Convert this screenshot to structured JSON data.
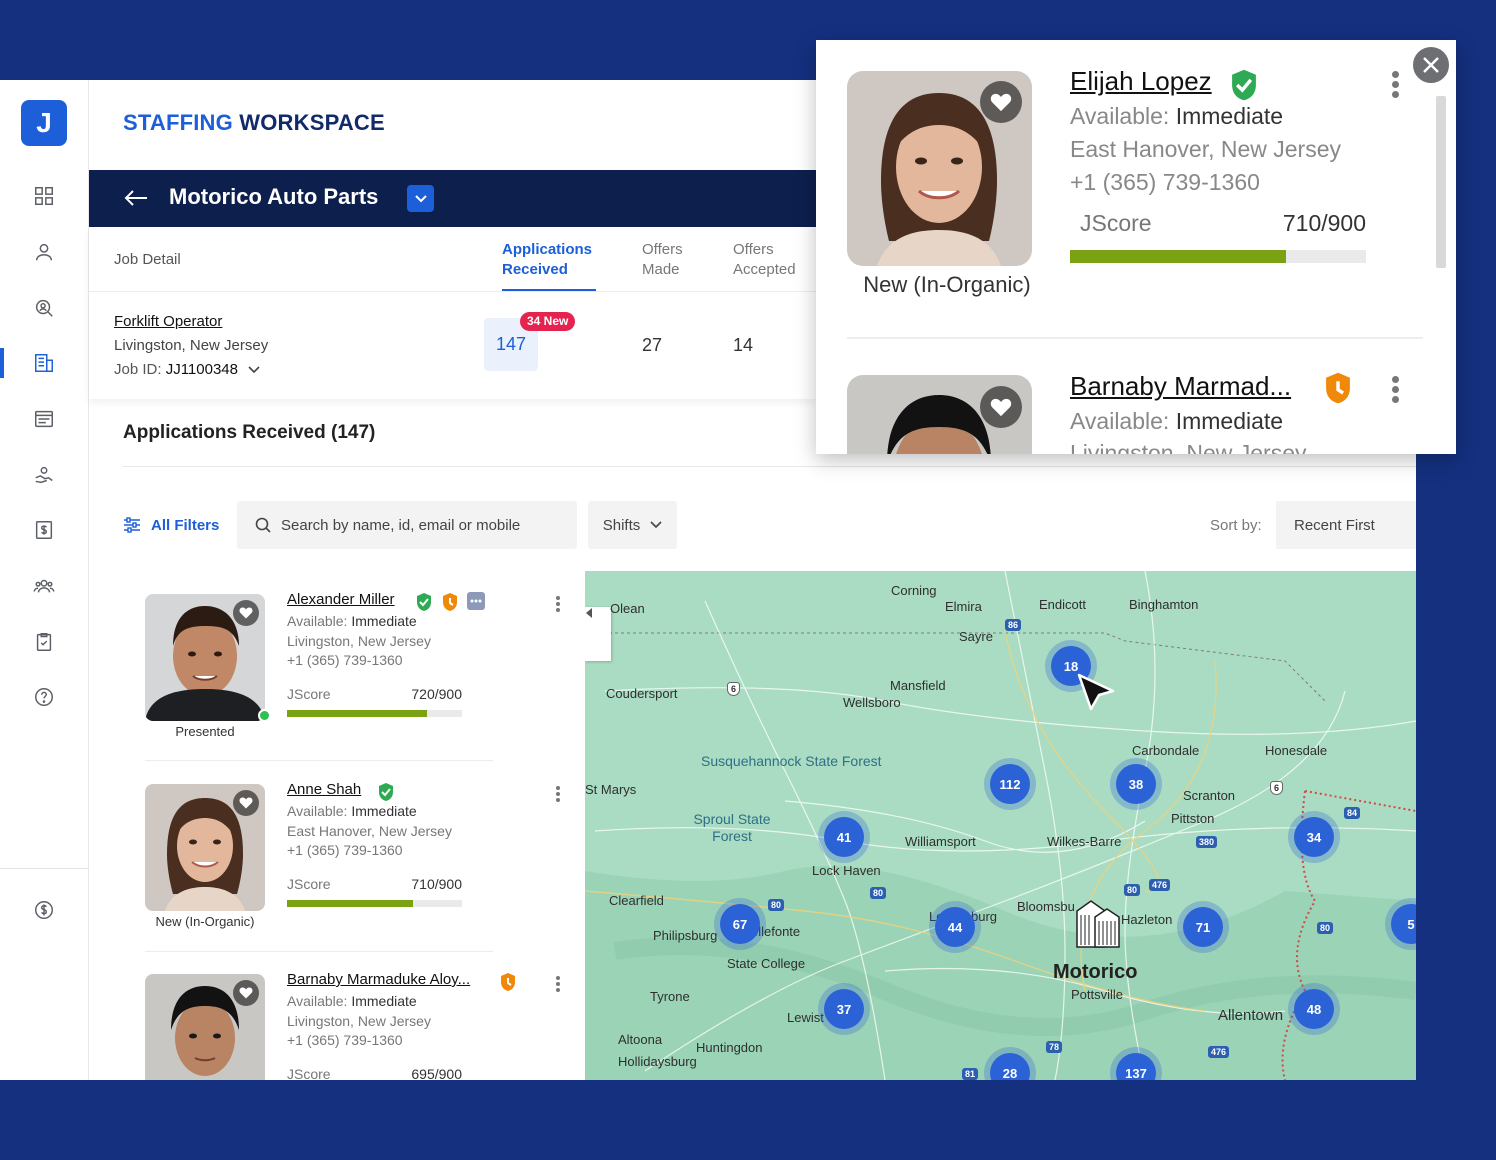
{
  "brand": {
    "part1": "STAFFING",
    "part2": "WORKSPACE",
    "logo_letter": "J"
  },
  "company": {
    "name": "Motorico Auto Parts"
  },
  "job_card": {
    "job_detail_label": "Job Detail",
    "columns": [
      {
        "label_line1": "Applications",
        "label_line2": "Received",
        "value": "147",
        "active": true
      },
      {
        "label_line1": "Offers",
        "label_line2": "Made",
        "value": "27"
      },
      {
        "label_line1": "Offers",
        "label_line2": "Accepted",
        "value": "14"
      }
    ],
    "new_badge": "34 New",
    "job_title": "Forklift Operator",
    "location": "Livingston, New Jersey",
    "job_id_label": "Job ID:",
    "job_id": "JJ1100348"
  },
  "section": {
    "title": "Applications Received (147)"
  },
  "filters": {
    "all_filters": "All Filters",
    "search_placeholder": "Search by name, id, email or mobile",
    "shifts": "Shifts",
    "sort_label": "Sort by:",
    "sort_value": "Recent First"
  },
  "candidates": [
    {
      "name": "Alexander Miller",
      "available_label": "Available:",
      "available": "Immediate",
      "location": "Livingston, New Jersey",
      "phone": "+1 (365) 739-1360",
      "jscore_label": "JScore",
      "jscore": "720/900",
      "jscore_fraction": 0.8,
      "status": "Presented"
    },
    {
      "name": "Anne Shah",
      "available_label": "Available:",
      "available": "Immediate",
      "location": "East Hanover, New Jersey",
      "phone": "+1 (365) 739-1360",
      "jscore_label": "JScore",
      "jscore": "710/900",
      "jscore_fraction": 0.72,
      "status": "New (In-Organic)"
    },
    {
      "name": "Barnaby Marmaduke Aloy...",
      "available_label": "Available:",
      "available": "Immediate",
      "location": "Livingston, New Jersey",
      "phone": "+1 (365) 739-1360",
      "jscore_label": "JScore",
      "jscore": "695/900",
      "jscore_fraction": 0.7,
      "status": ""
    }
  ],
  "map": {
    "labels": [
      "Corning",
      "Elmira",
      "Endicott",
      "Binghamton",
      "Olean",
      "Sayre",
      "Coudersport",
      "Mansfield",
      "Wellsboro",
      "Carbondale",
      "Honesdale",
      "St Marys",
      "Scranton",
      "Pittston",
      "Williamsport",
      "Wilkes-Barre",
      "Lock Haven",
      "Clearfield",
      "Bloomsbu",
      "Hazleton",
      "Philipsburg",
      "ellefonte",
      "State College",
      "Tyrone",
      "Lewist",
      "Pottsville",
      "Allentown",
      "Altoona",
      "Huntingdon",
      "Hollidaysburg",
      "Le",
      "burg"
    ],
    "forests": [
      "Susquehannock State Forest",
      "Sproul State Forest"
    ],
    "clusters": [
      "18",
      "112",
      "38",
      "41",
      "34",
      "67",
      "44",
      "71",
      "5",
      "37",
      "48",
      "28",
      "137"
    ],
    "destination": "Motorico"
  },
  "popup": {
    "candidates": [
      {
        "name": "Elijah Lopez",
        "available_label": "Available:",
        "available": "Immediate",
        "location": "East Hanover, New Jersey",
        "phone": "+1 (365) 739-1360",
        "jscore_label": "JScore",
        "jscore": "710/900",
        "jscore_fraction": 0.73,
        "status": "New (In-Organic)"
      },
      {
        "name": "Barnaby Marmad...",
        "available_label": "Available:",
        "available": "Immediate",
        "location": "Livingston, New Jersey"
      }
    ]
  },
  "colors": {
    "accent": "#1c5fd8",
    "navy": "#0d1f4d",
    "background": "#14307f",
    "score": "#7ba213",
    "badge_new": "#e5234f"
  }
}
